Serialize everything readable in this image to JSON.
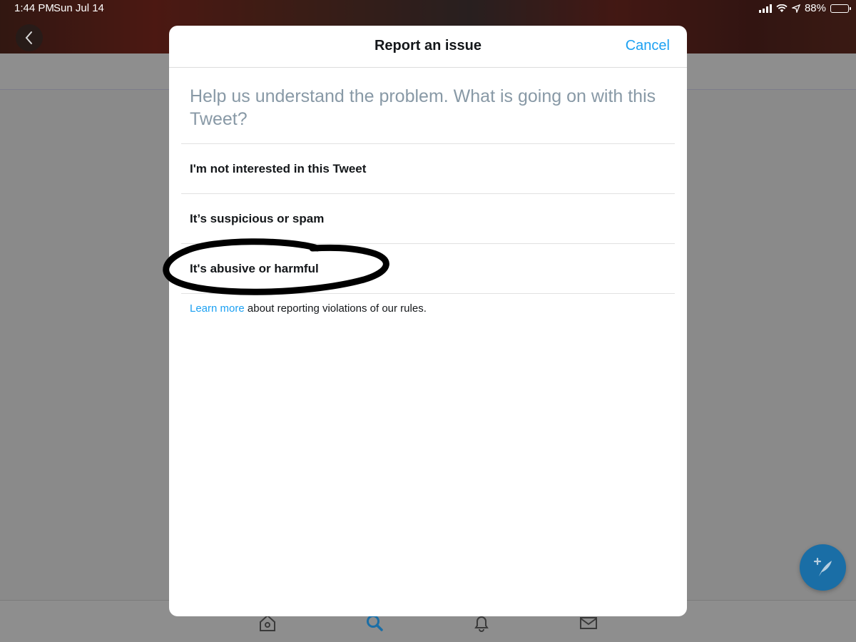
{
  "status_bar": {
    "time": "1:44 PM",
    "date": "Sun Jul 14",
    "battery": "88%",
    "battery_level": 0.88
  },
  "modal": {
    "title": "Report an issue",
    "cancel_label": "Cancel",
    "prompt": "Help us understand the problem. What is going on with this Tweet?",
    "options": [
      {
        "label": "I'm not interested in this Tweet"
      },
      {
        "label": "It’s suspicious or spam"
      },
      {
        "label": "It's abusive or harmful"
      }
    ],
    "learn_more_link": "Learn more",
    "learn_more_text": " about reporting violations of our rules."
  },
  "colors": {
    "accent": "#1da1f2",
    "prompt_text": "#8899a6",
    "fab": "#1a6ea6"
  },
  "icons": {
    "back": "chevron-left-icon",
    "tabs": [
      "home-icon",
      "search-icon",
      "bell-icon",
      "mail-icon"
    ],
    "compose": "compose-tweet-icon"
  }
}
